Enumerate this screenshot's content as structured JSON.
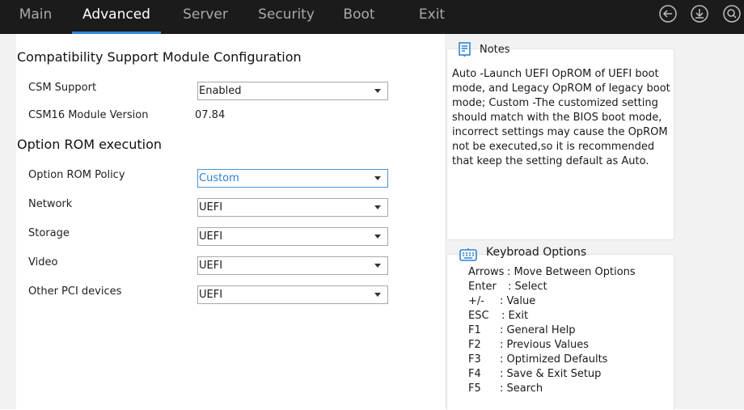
{
  "nav": {
    "tabs": [
      {
        "label": "Main"
      },
      {
        "label": "Advanced"
      },
      {
        "label": "Server"
      },
      {
        "label": "Security"
      },
      {
        "label": "Boot"
      },
      {
        "label": "Exit"
      }
    ],
    "active_tab": "Advanced",
    "icons": [
      "back-icon",
      "download-icon",
      "search-icon"
    ]
  },
  "main": {
    "csm_title": "Compatibility Support Module Configuration",
    "csm_support": {
      "label": "CSM Support",
      "value": "Enabled"
    },
    "csm16_version": {
      "label": "CSM16 Module Version",
      "value": "07.84"
    },
    "oprom_title": "Option ROM execution",
    "oprom_policy": {
      "label": "Option ROM Policy",
      "value": "Custom"
    },
    "network": {
      "label": "Network",
      "value": "UEFI"
    },
    "storage": {
      "label": "Storage",
      "value": "UEFI"
    },
    "video": {
      "label": "Video",
      "value": "UEFI"
    },
    "other_pci": {
      "label": "Other PCI devices",
      "value": "UEFI"
    }
  },
  "notes": {
    "title": "Notes",
    "text": "Auto -Launch UEFI OpROM of UEFI boot mode, and Legacy OpROM of legacy boot mode; Custom -The customized setting should match with the BIOS boot mode, incorrect settings may cause the OpROM not be executed,so it is recommended that keep the setting default as Auto."
  },
  "keyboard": {
    "title": "Keybroad Options",
    "rows": [
      {
        "key": "Arrows",
        "desc": ": Move Between Options"
      },
      {
        "key": "Enter",
        "desc": ": Select"
      },
      {
        "key": "+/-",
        "desc": ": Value"
      },
      {
        "key": "ESC",
        "desc": ": Exit"
      },
      {
        "key": "F1",
        "desc": ": General Help"
      },
      {
        "key": "F2",
        "desc": ": Previous Values"
      },
      {
        "key": "F3",
        "desc": ": Optimized Defaults"
      },
      {
        "key": "F4",
        "desc": ": Save & Exit Setup"
      },
      {
        "key": "F5",
        "desc": ": Search"
      }
    ]
  },
  "colors": {
    "accent": "#2f86d6",
    "topbar": "#1b1b1b",
    "panel": "#f2f2f2"
  }
}
